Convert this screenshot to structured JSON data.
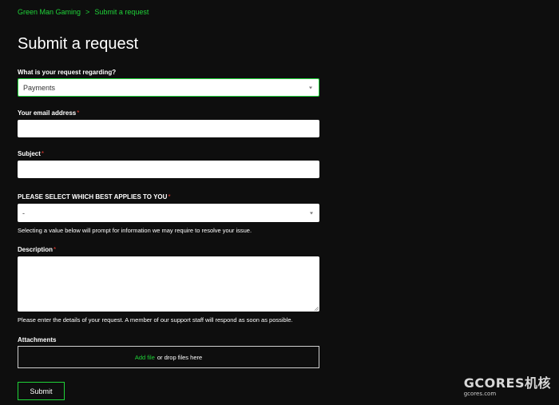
{
  "breadcrumb": {
    "home": "Green Man Gaming",
    "separator": ">",
    "current": "Submit a request"
  },
  "page_title": "Submit a request",
  "form": {
    "request_type": {
      "label": "What is your request regarding?",
      "value": "Payments"
    },
    "email": {
      "label": "Your email address",
      "required_mark": "*",
      "value": ""
    },
    "subject": {
      "label": "Subject",
      "required_mark": "*",
      "value": ""
    },
    "applies_to": {
      "label": "PLEASE SELECT WHICH BEST APPLIES TO YOU",
      "required_mark": "*",
      "value": "-",
      "hint": "Selecting a value below will prompt for information we may require to resolve your issue."
    },
    "description": {
      "label": "Description",
      "required_mark": "*",
      "value": "",
      "hint": "Please enter the details of your request. A member of our support staff will respond as soon as possible."
    },
    "attachments": {
      "label": "Attachments",
      "add_file": "Add file",
      "drop_text": "or drop files here"
    },
    "submit_label": "Submit"
  },
  "watermark": {
    "main": "GCORES机核",
    "sub": "gcores.com"
  },
  "colors": {
    "background": "#0e0e0e",
    "accent": "#1fd338",
    "required": "#e0392f"
  }
}
